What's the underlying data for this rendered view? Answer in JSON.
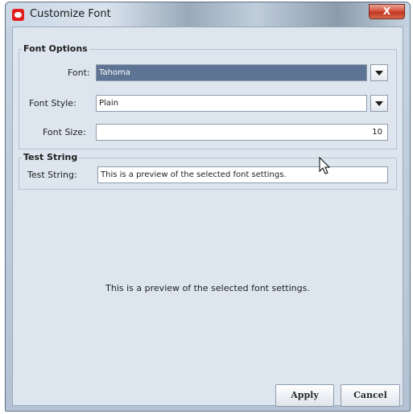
{
  "window": {
    "title": "Customize Font",
    "close_label": "X"
  },
  "font_options": {
    "legend": "Font Options",
    "font_label": "Font:",
    "font_value": "Tahoma",
    "style_label": "Font Style:",
    "style_value": "Plain",
    "size_label": "Font Size:",
    "size_value": "10"
  },
  "test_string": {
    "legend": "Test String",
    "label": "Test String:",
    "value": "This is a preview of the selected font settings."
  },
  "preview": {
    "text": "This is a preview of the selected font settings."
  },
  "buttons": {
    "apply": "Apply",
    "cancel": "Cancel"
  },
  "icons": [
    "app-icon",
    "close-icon",
    "dropdown-arrow-icon",
    "mouse-cursor-icon"
  ]
}
